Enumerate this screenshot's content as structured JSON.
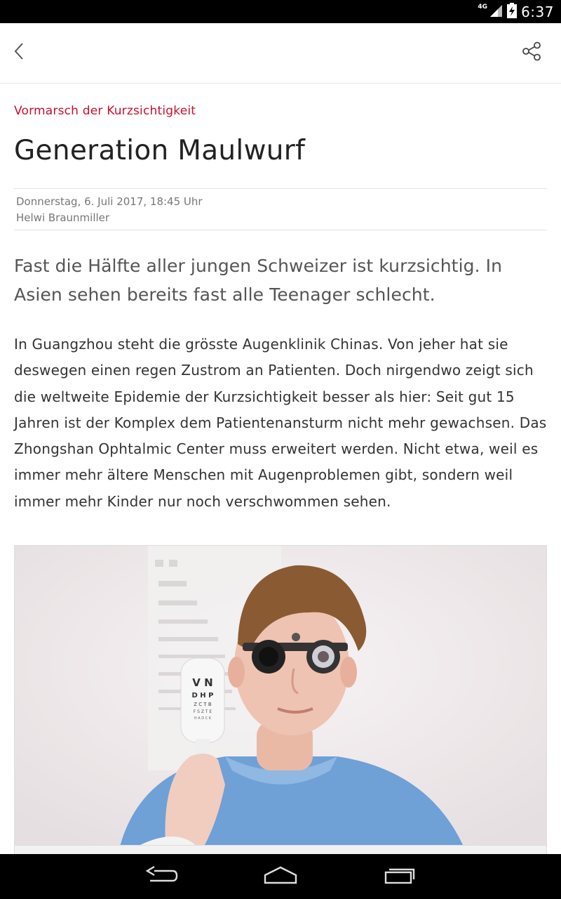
{
  "status_bar": {
    "network_label": "4G",
    "time": "6:37"
  },
  "toolbar": {
    "back_icon": "chevron-left-icon",
    "share_icon": "share-icon"
  },
  "article": {
    "kicker": "Vormarsch der Kurzsichtigkeit",
    "title": "Generation Maulwurf",
    "date": "Donnerstag, 6. Juli 2017, 18:45 Uhr",
    "author": "Helwi Braunmiller",
    "lead": "Fast die Hälfte aller jungen Schweizer ist kurzsichtig. In Asien sehen bereits fast alle Teenager schlecht.",
    "body": "In Guangzhou steht die grösste Augenklinik Chinas. Von jeher hat sie deswegen einen regen Zustrom an Patienten. Doch nirgendwo zeigt sich die weltweite Epidemie der Kurzsichtigkeit besser als hier: Seit gut 15 Jahren ist der Komplex dem Patientenansturm nicht mehr gewachsen. Das Zhongshan Ophtalmic Center muss erweitert werden. Nicht etwa, weil es immer mehr ältere Menschen mit Augenproblemen gibt, sondern weil immer mehr Kinder nur noch verschwommen sehen.",
    "image": {
      "chart_row1": "V N",
      "chart_row2": "D H P",
      "chart_row3": "Z C T B",
      "chart_row4": "F S Z T E",
      "chart_row5": "H A D C K"
    }
  },
  "colors": {
    "accent": "#c8102e"
  }
}
